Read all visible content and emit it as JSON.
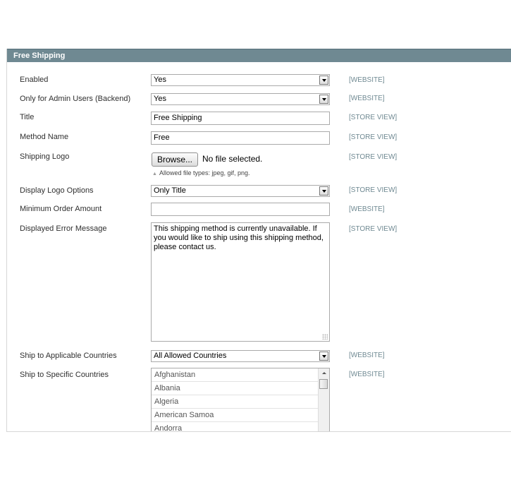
{
  "section": {
    "title": "Free Shipping"
  },
  "fields": {
    "enabled": {
      "label": "Enabled",
      "value": "Yes",
      "scope": "[WEBSITE]"
    },
    "admin_only": {
      "label": "Only for Admin Users (Backend)",
      "value": "Yes",
      "scope": "[WEBSITE]"
    },
    "title": {
      "label": "Title",
      "value": "Free Shipping",
      "scope": "[STORE VIEW]"
    },
    "method_name": {
      "label": "Method Name",
      "value": "Free",
      "scope": "[STORE VIEW]"
    },
    "logo": {
      "label": "Shipping Logo",
      "button": "Browse...",
      "status": "No file selected.",
      "hint": "Allowed file types: jpeg, gif, png.",
      "scope": "[STORE VIEW]"
    },
    "display_logo": {
      "label": "Display Logo Options",
      "value": "Only Title",
      "scope": "[STORE VIEW]"
    },
    "min_order": {
      "label": "Minimum Order Amount",
      "value": "",
      "scope": "[WEBSITE]"
    },
    "error_message": {
      "label": "Displayed Error Message",
      "value": "This shipping method is currently unavailable. If you would like to ship using this shipping method, please contact us.",
      "scope": "[STORE VIEW]"
    },
    "applicable_countries": {
      "label": "Ship to Applicable Countries",
      "value": "All Allowed Countries",
      "scope": "[WEBSITE]"
    },
    "specific_countries": {
      "label": "Ship to Specific Countries",
      "scope": "[WEBSITE]",
      "options": [
        "Afghanistan",
        "Albania",
        "Algeria",
        "American Samoa",
        "Andorra"
      ]
    }
  }
}
